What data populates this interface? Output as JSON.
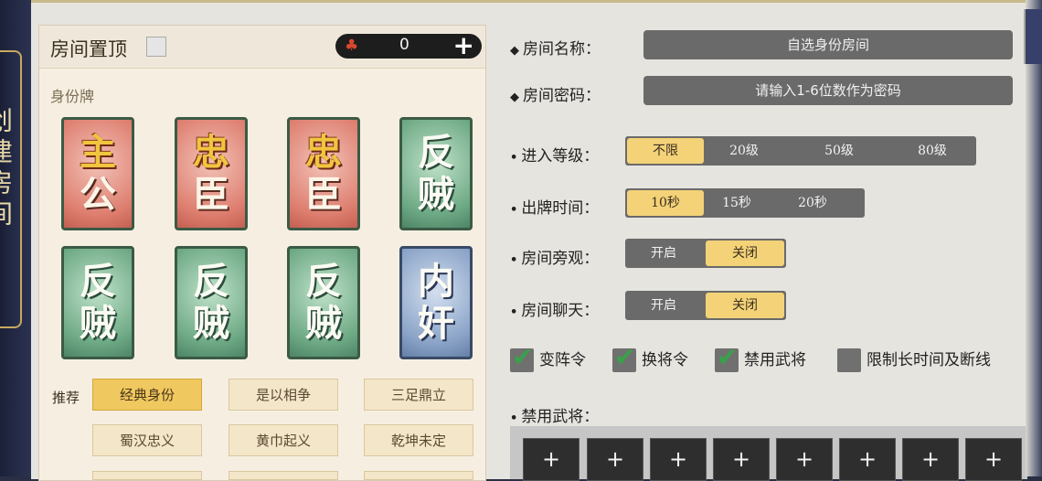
{
  "side_tab": {
    "label": "创建房间"
  },
  "left": {
    "pin_label": "房间置顶",
    "coin_value": "0",
    "coin_icon": "coin-icon",
    "identity_label": "身份牌",
    "cards": [
      {
        "top": "主",
        "bottom": "公",
        "faction": "lord",
        "color": "#de7f70"
      },
      {
        "top": "忠",
        "bottom": "臣",
        "faction": "loyal",
        "color": "#de7f70"
      },
      {
        "top": "忠",
        "bottom": "臣",
        "faction": "loyal",
        "color": "#de7f70"
      },
      {
        "top": "反",
        "bottom": "贼",
        "faction": "rebel",
        "color": "#6ea985"
      },
      {
        "top": "反",
        "bottom": "贼",
        "faction": "rebel",
        "color": "#6ea985"
      },
      {
        "top": "反",
        "bottom": "贼",
        "faction": "rebel",
        "color": "#6ea985"
      },
      {
        "top": "反",
        "bottom": "贼",
        "faction": "rebel",
        "color": "#6ea985"
      },
      {
        "top": "内",
        "bottom": "奸",
        "faction": "spy",
        "color": "#8aa3c7"
      }
    ],
    "recommend_label": "推荐",
    "presets": [
      "经典身份",
      "是以相争",
      "三足鼎立",
      "蜀汉忠义",
      "黄巾起义",
      "乾坤未定"
    ],
    "active_preset": "经典身份"
  },
  "right": {
    "room_name_label": "房间名称：",
    "room_name_value": "自选身份房间",
    "password_label": "房间密码：",
    "password_placeholder": "请输入1-6位数作为密码",
    "level_label": "进入等级：",
    "level_options": [
      "不限",
      "20级",
      "50级",
      "80级"
    ],
    "level_selected": "不限",
    "time_label": "出牌时间：",
    "time_options": [
      "10秒",
      "15秒",
      "20秒"
    ],
    "time_selected": "10秒",
    "spectate_label": "房间旁观：",
    "spectate_options": [
      "开启",
      "关闭"
    ],
    "spectate_selected": "关闭",
    "chat_label": "房间聊天：",
    "chat_options": [
      "开启",
      "关闭"
    ],
    "chat_selected": "关闭",
    "checkboxes": [
      {
        "label": "变阵令",
        "checked": true
      },
      {
        "label": "换将令",
        "checked": true
      },
      {
        "label": "禁用武将",
        "checked": true
      },
      {
        "label": "限制长时间及断线",
        "checked": false
      }
    ],
    "ban_label": "禁用武将：",
    "ban_slot_text": "+",
    "ban_slot_count": 8
  },
  "colors": {
    "accent_gold": "#f3d278",
    "check_green": "#3aa04a"
  }
}
